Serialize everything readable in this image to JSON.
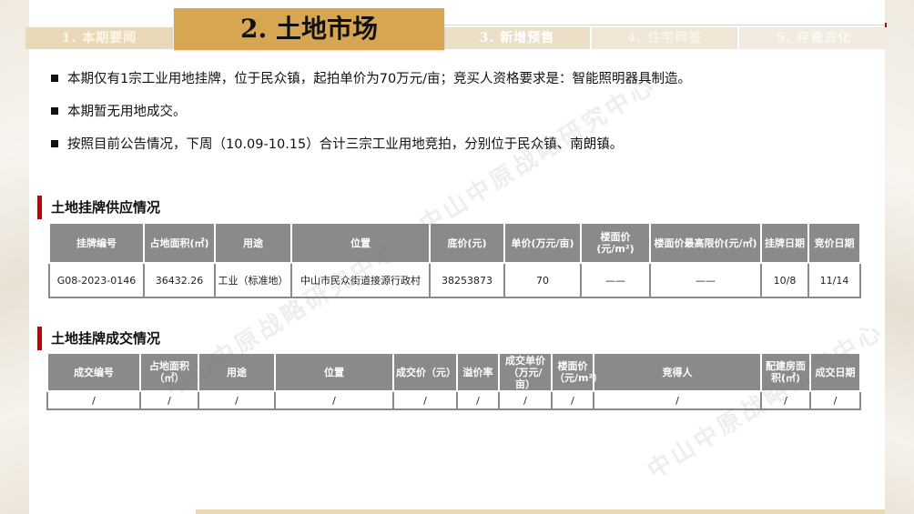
{
  "nav": {
    "tabs": [
      {
        "label": "1. 本期要闻"
      },
      {
        "label": "2. 土地市场"
      },
      {
        "label": "3. 新增预售"
      },
      {
        "label": "4. 住宅网签"
      },
      {
        "label": "5. 存量去化"
      }
    ]
  },
  "bullets": [
    "本期仅有1宗工业用地挂牌，位于民众镇，起拍单价为70万元/亩；竞买人资格要求是：智能照明器具制造。",
    "本期暂无用地成交。",
    "按照目前公告情况，下周（10.09-10.15）合计三宗工业用地竞拍，分别位于民众镇、南朗镇。"
  ],
  "supply": {
    "title": "土地挂牌供应情况",
    "headers": [
      "挂牌编号",
      "占地面积(㎡)",
      "用途",
      "位置",
      "底价(元)",
      "单价(万元/亩)",
      "楼面价(元/m²)",
      "楼面价最高限价(元/㎡)",
      "挂牌日期",
      "竞价日期"
    ],
    "rows": [
      [
        "G08-2023-0146",
        "36432.26",
        "工业（标准地）",
        "中山市民众街道接源行政村",
        "38253873",
        "70",
        "——",
        "——",
        "10/8",
        "11/14"
      ]
    ]
  },
  "deal": {
    "title": "土地挂牌成交情况",
    "headers": [
      "成交编号",
      "占地面积（㎡）",
      "用途",
      "位置",
      "成交价（元）",
      "溢价率",
      "成交单价（万元/亩）",
      "楼面价（元/m²）",
      "竞得人",
      "配建房面积(㎡)",
      "成交日期"
    ],
    "rows": [
      [
        "/",
        "/",
        "/",
        "/",
        "/",
        "/",
        "/",
        "/",
        "/",
        "/",
        "/"
      ]
    ]
  },
  "watermark": "中山中原战略研究中心"
}
